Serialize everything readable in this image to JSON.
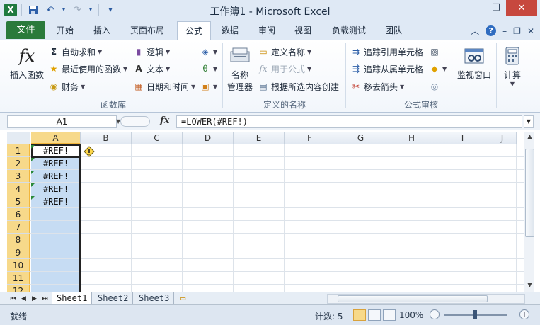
{
  "window": {
    "title": "工作簿1 - Microsoft Excel",
    "minimize": "–",
    "restore": "❐",
    "close": "✕"
  },
  "qat": {
    "logo": "X",
    "save": "💾",
    "undo": "↶",
    "redo": "↷",
    "customize": "▾"
  },
  "tabs": {
    "file": "文件",
    "items": [
      "开始",
      "插入",
      "页面布局",
      "公式",
      "数据",
      "审阅",
      "视图",
      "负载测试",
      "团队"
    ],
    "active_index": 3
  },
  "ribbon": {
    "function_library": {
      "label": "函数库",
      "insert_function": "插入函数",
      "autosum": "自动求和",
      "recent": "最近使用的函数",
      "financial": "财务",
      "logical": "逻辑",
      "text": "文本",
      "datetime": "日期和时间"
    },
    "defined_names": {
      "label": "定义的名称",
      "name_manager_line1": "名称",
      "name_manager_line2": "管理器",
      "define_name": "定义名称",
      "use_in_formula": "用于公式",
      "create_from_selection": "根据所选内容创建"
    },
    "formula_auditing": {
      "label": "公式审核",
      "trace_precedents": "追踪引用单元格",
      "trace_dependents": "追踪从属单元格",
      "remove_arrows": "移去箭头",
      "watch_window": "监视窗口"
    },
    "calculation": {
      "label": "计算"
    }
  },
  "formula_bar": {
    "name_box": "A1",
    "fx": "fx",
    "formula": "=LOWER(#REF!)"
  },
  "grid": {
    "columns": [
      "A",
      "B",
      "C",
      "D",
      "E",
      "F",
      "G",
      "H",
      "I",
      "J"
    ],
    "rows": [
      "1",
      "2",
      "3",
      "4",
      "5",
      "6",
      "7",
      "8",
      "9",
      "10",
      "11",
      "12"
    ],
    "cells_A": [
      "#REF!",
      "#REF!",
      "#REF!",
      "#REF!",
      "#REF!"
    ]
  },
  "sheets": {
    "tabs": [
      "Sheet1",
      "Sheet2",
      "Sheet3"
    ],
    "active_index": 0
  },
  "status": {
    "mode": "就绪",
    "count": "计数: 5",
    "zoom": "100%"
  },
  "colors": {
    "file_tab": "#2a7a3b",
    "selection": "#c6dcf3",
    "header_highlight": "#f7d98a"
  }
}
